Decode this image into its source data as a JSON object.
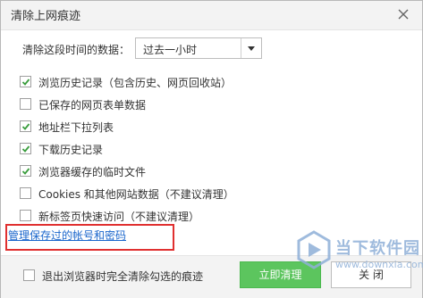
{
  "window": {
    "title": "清除上网痕迹"
  },
  "time_range": {
    "label": "清除这段时间的数据：",
    "selected": "过去一小时"
  },
  "options": [
    {
      "label": "浏览历史记录（包含历史、网页回收站）",
      "checked": true
    },
    {
      "label": "已保存的网页表单数据",
      "checked": false
    },
    {
      "label": "地址栏下拉列表",
      "checked": true
    },
    {
      "label": "下载历史记录",
      "checked": true
    },
    {
      "label": "浏览器缓存的临时文件",
      "checked": true
    },
    {
      "label": "Cookies 和其他网站数据（不建议清理）",
      "checked": false
    },
    {
      "label": "新标签页快速访问（不建议清理）",
      "checked": false
    }
  ],
  "manage_link": "管理保存过的帐号和密码",
  "footer": {
    "exit_clear_label": "退出浏览器时完全清除勾选的痕迹",
    "exit_clear_checked": false,
    "primary_button": "立即清理",
    "close_button": "关 闭"
  },
  "watermark": {
    "text": "当下软件园",
    "url": "www.downxia.com"
  },
  "colors": {
    "accent_green": "#5cc55e",
    "link_blue": "#1a66cc",
    "highlight_red": "#e03030"
  }
}
